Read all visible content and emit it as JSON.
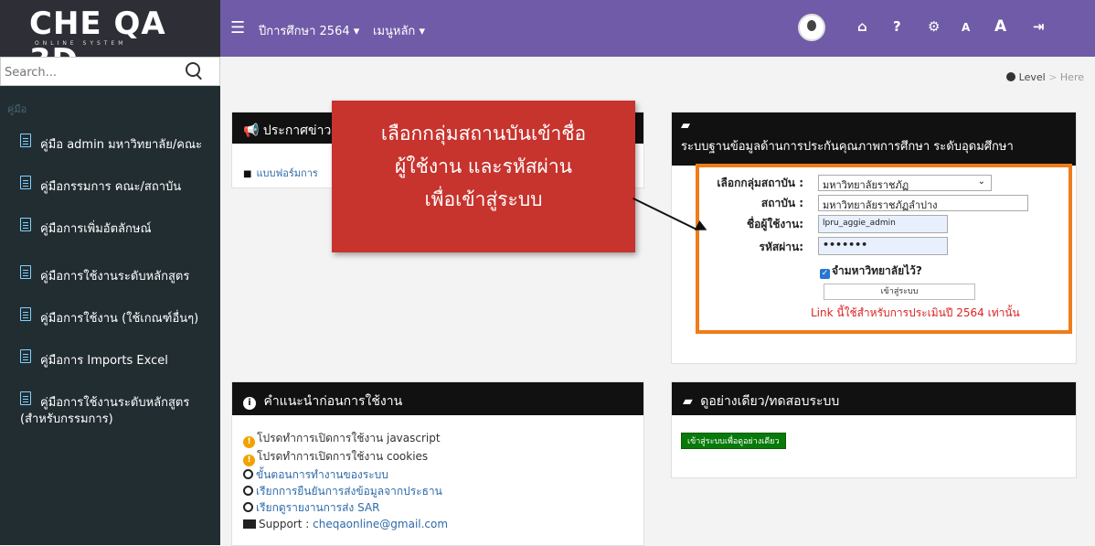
{
  "app": {
    "logo": "CHE QA 3D",
    "logo_sub": "ONLINE SYSTEM"
  },
  "topbar": {
    "year_menu": "ปีการศึกษา 2564 ▾",
    "main_menu": "เมนูหลัก ▾",
    "icons": [
      "avatar",
      "home-icon",
      "help-icon",
      "settings-icon",
      "font-small-icon",
      "font-large-icon",
      "logout-icon"
    ],
    "font_small": "A",
    "font_large": "A"
  },
  "sidebar": {
    "search_placeholder": "Search...",
    "header": "คู่มือ",
    "items": [
      {
        "label": "คู่มือ admin มหาวิทยาลัย/คณะ"
      },
      {
        "label": "คู่มือกรรมการ คณะ/สถาบัน"
      },
      {
        "label": "คู่มือการเพิ่มอัตลักษณ์"
      },
      {
        "label": "คู่มือการใช้งานระดับหลักสูตร"
      },
      {
        "label": "คู่มือการใช้งาน (ใช้เกณฑ์อื่นๆ)"
      },
      {
        "label": "คู่มือการ Imports Excel"
      },
      {
        "label": "คู่มือการใช้งานระดับหลักสูตร",
        "label2": "(สำหรับกรรมการ)"
      }
    ]
  },
  "breadcrumb": {
    "level": "Level",
    "sep": ">",
    "here": "Here"
  },
  "announce": {
    "title": "ประกาศข่าว",
    "item": "แบบฟอร์มการ"
  },
  "login": {
    "title": "ระบบฐานข้อมูลด้านการประกันคุณภาพการศึกษา ระดับอุดมศึกษา",
    "group_label": "เลือกกลุ่มสถาบัน :",
    "group_value": "มหาวิทยาลัยราชภัฏ",
    "inst_label": "สถาบัน :",
    "inst_value": "มหาวิทยาลัยราชภัฏลำปาง",
    "user_label": "ชื่อผู้ใช้งาน:",
    "user_value": "lpru_aggie_admin",
    "pass_label": "รหัสผ่าน:",
    "pass_value": "•••••••",
    "remember": "จำมหาวิทยาลัยไว้?",
    "button": "เข้าสู่ระบบ",
    "note": "Link นี้ใช้สำหรับการประเมินปี 2564 เท่านั้น"
  },
  "guide": {
    "title": "คำแนะนำก่อนการใช้งาน",
    "items": [
      "โปรดทำการเปิดการใช้งาน javascript",
      "โปรดทำการเปิดการใช้งาน cookies",
      "ขั้นตอนการทำงานของระบบ",
      "เรียกการยืนยันการส่งข้อมูลจากประธาน",
      "เรียกดูรายงานการส่ง SAR"
    ],
    "support_label": "Support :",
    "support_email": "cheqaonline@gmail.com"
  },
  "demo": {
    "title": "ดูอย่างเดียว/ทดสอบระบบ",
    "button": "เข้าสู่ระบบเพื่อดูอย่างเดียว"
  },
  "callout": {
    "line1": "เลือกกลุ่มสถานบันเข้าชื่อ",
    "line2": "ผู้ใช้งาน และรหัสผ่าน",
    "line3": "เพื่อเข้าสู่ระบบ"
  }
}
